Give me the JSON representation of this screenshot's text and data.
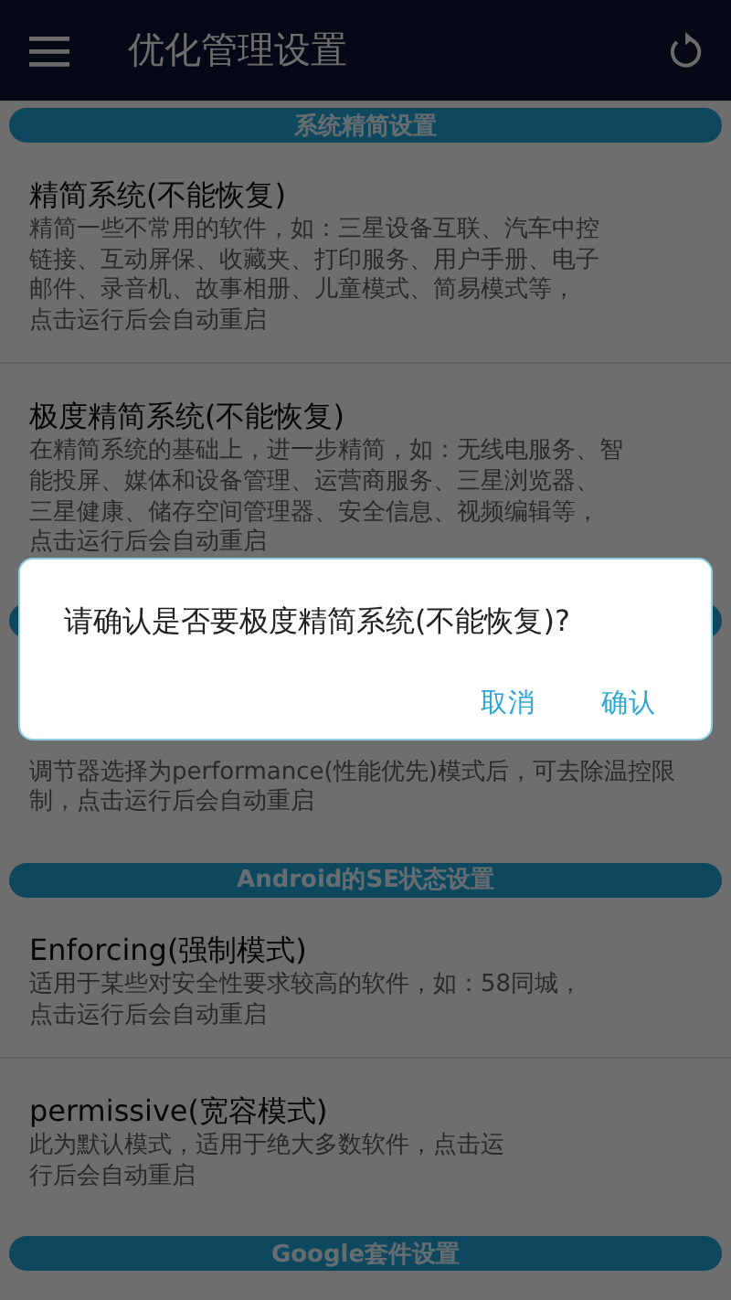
{
  "toolbar": {
    "title": "优化管理设置"
  },
  "sections": [
    {
      "title": "系统精简设置",
      "items": [
        {
          "title": "精简系统(不能恢复)",
          "lines": [
            "精简一些不常用的软件，如：三星设备互联、汽车中控",
            "链接、互动屏保、收藏夹、打印服务、用户手册、电子",
            "邮件、录音机、故事相册、儿童模式、简易模式等，",
            "点击运行后会自动重启"
          ]
        },
        {
          "title": "极度精简系统(不能恢复)",
          "lines": [
            "在精简系统的基础上，进一步精简，如：无线电服务、智",
            "能投屏、媒体和设备管理、运营商服务、三星浏览器、",
            "三星健康、储存空间管理器、安全信息、视频编辑等，",
            "点击运行后会自动重启"
          ]
        }
      ]
    },
    {
      "items": [
        {
          "lines": [
            "调节器选择为performance(性能优先)模式后，可去除温控限",
            "制，点击运行后会自动重启"
          ]
        }
      ]
    },
    {
      "title": "Android的SE状态设置",
      "items": [
        {
          "title": "Enforcing(强制模式)",
          "lines": [
            "适用于某些对安全性要求较高的软件，如：58同城，",
            "点击运行后会自动重启"
          ]
        },
        {
          "title": "permissive(宽容模式)",
          "lines": [
            "此为默认模式，适用于绝大多数软件，点击运",
            "行后会自动重启"
          ]
        }
      ]
    },
    {
      "title": "Google套件设置"
    }
  ],
  "dialog": {
    "message": "请确认是否要极度精简系统(不能恢复)?",
    "buttons": [
      "取消",
      "确认"
    ]
  }
}
